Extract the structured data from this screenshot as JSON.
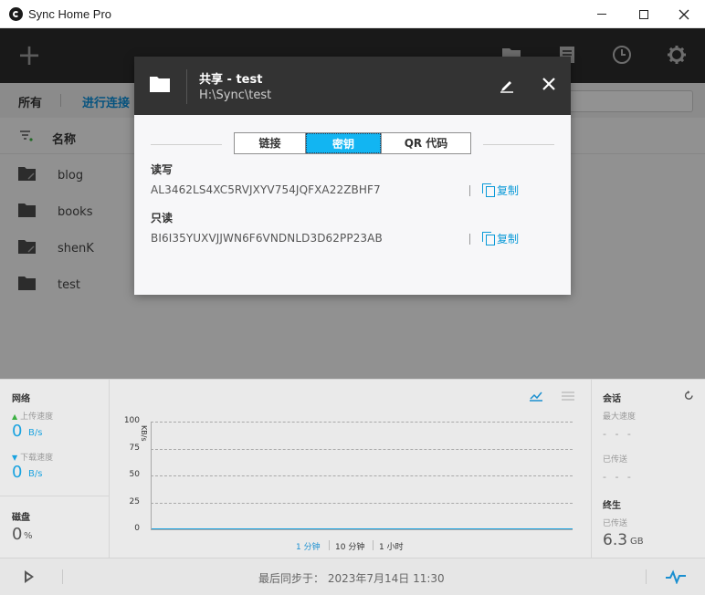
{
  "window": {
    "title": "Sync Home Pro"
  },
  "toolbar": {
    "add_label": "+"
  },
  "nav": {
    "all": "所有",
    "connected": "进行连接"
  },
  "list": {
    "column_name": "名称",
    "folders": [
      "blog",
      "books",
      "shenK",
      "test"
    ]
  },
  "bottom": {
    "network": {
      "title": "网络",
      "upload_label": "上传速度",
      "upload_value": "0",
      "upload_unit": "B/s",
      "download_label": "下载速度",
      "download_value": "0",
      "download_unit": "B/s"
    },
    "disk": {
      "title": "磁盘",
      "value": "0",
      "unit": "%"
    },
    "chart": {
      "ylabel": "KB/s",
      "ranges": [
        "1 分钟",
        "10 分钟",
        "1 小时"
      ],
      "active_range": "1 分钟",
      "accent_color": "#1aa3e0"
    },
    "session": {
      "title": "会话",
      "max_speed_label": "最大速度",
      "max_speed_value": "- - -",
      "sent_label": "已传送",
      "sent_value": "- - -"
    },
    "lifetime": {
      "title": "终生",
      "sent_label": "已传送",
      "sent_value": "6.3",
      "sent_unit": "GB"
    }
  },
  "status": {
    "last_sync": "最后同步于： 2023年7月14日 11:30"
  },
  "modal": {
    "title": "共享 - test",
    "path": "H:\\Sync\\test",
    "tabs": [
      "链接",
      "密钥",
      "QR 代码"
    ],
    "active_tab": "密钥",
    "read_write_label": "读写",
    "read_write_key": "AL3462LS4XC5RVJXYV754JQFXA22ZBHF7",
    "read_only_label": "只读",
    "read_only_key": "BI6I35YUXVJJWN6F6VNDNLD3D62PP23AB",
    "copy_label": "复制",
    "accent_color": "#12b5f2"
  },
  "chart_data": {
    "type": "line",
    "ylabel": "KB/s",
    "yticks": [
      0,
      25,
      50,
      75,
      100
    ],
    "ylim": [
      0,
      100
    ],
    "series": [
      {
        "values": [
          0,
          0
        ]
      }
    ],
    "grid": true
  }
}
